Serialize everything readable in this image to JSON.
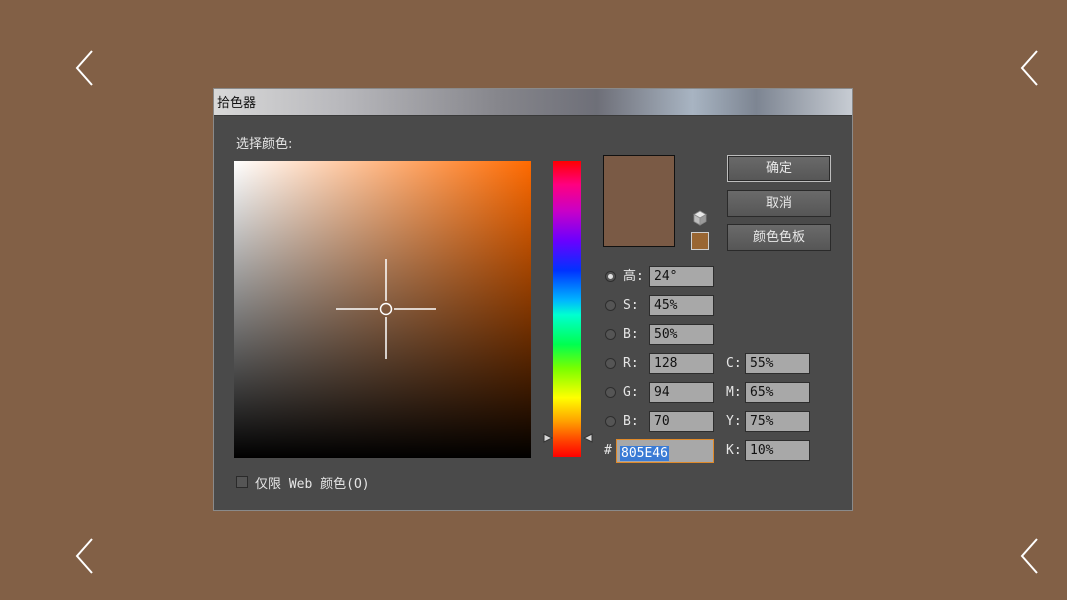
{
  "background_color": "#826046",
  "nav": {
    "top_left": "chevron-left-icon",
    "top_right": "chevron-left-icon",
    "bottom_left": "chevron-left-icon",
    "bottom_right": "chevron-left-icon"
  },
  "dialog": {
    "title": "拾色器",
    "select_label": "选择颜色:",
    "buttons": {
      "ok": "确定",
      "cancel": "取消",
      "swatches": "颜色色板"
    },
    "preview_color": "#7a5a45",
    "web_swatch_color": "#996633",
    "hue_value": 24,
    "fields": {
      "hsb": [
        {
          "label": "高:",
          "value": "24°",
          "checked": true
        },
        {
          "label": "S:",
          "value": "45%",
          "checked": false
        },
        {
          "label": "B:",
          "value": "50%",
          "checked": false
        }
      ],
      "rgb": [
        {
          "label": "R:",
          "value": "128",
          "checked": false
        },
        {
          "label": "G:",
          "value": "94",
          "checked": false
        },
        {
          "label": "B:",
          "value": "70",
          "checked": false
        }
      ],
      "cmyk": [
        {
          "label": "C:",
          "value": "55%"
        },
        {
          "label": "M:",
          "value": "65%"
        },
        {
          "label": "Y:",
          "value": "75%"
        },
        {
          "label": "K:",
          "value": "10%"
        }
      ],
      "hex_label": "#",
      "hex_value": "805E46"
    },
    "web_only_label": "仅限 Web 颜色(O)",
    "web_only_checked": false
  }
}
